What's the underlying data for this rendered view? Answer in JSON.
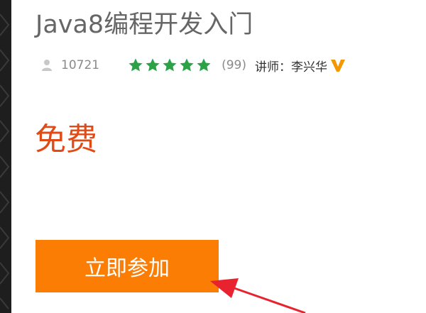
{
  "course": {
    "title": "Java8编程开发入门",
    "learners": "10721",
    "rating_count": "(99)",
    "teacher": "讲师：李兴华",
    "stars": 5,
    "price": "免费",
    "join_label": "立即参加"
  },
  "icons": {
    "learners": "user-icon",
    "star": "star-icon",
    "verified": "v-badge-icon",
    "annotation": "red-arrow"
  },
  "colors": {
    "star": "#2ba246",
    "price": "#e04a16",
    "button": "#fb7d04",
    "badge": "#f39800",
    "arrow": "#e8232f"
  }
}
